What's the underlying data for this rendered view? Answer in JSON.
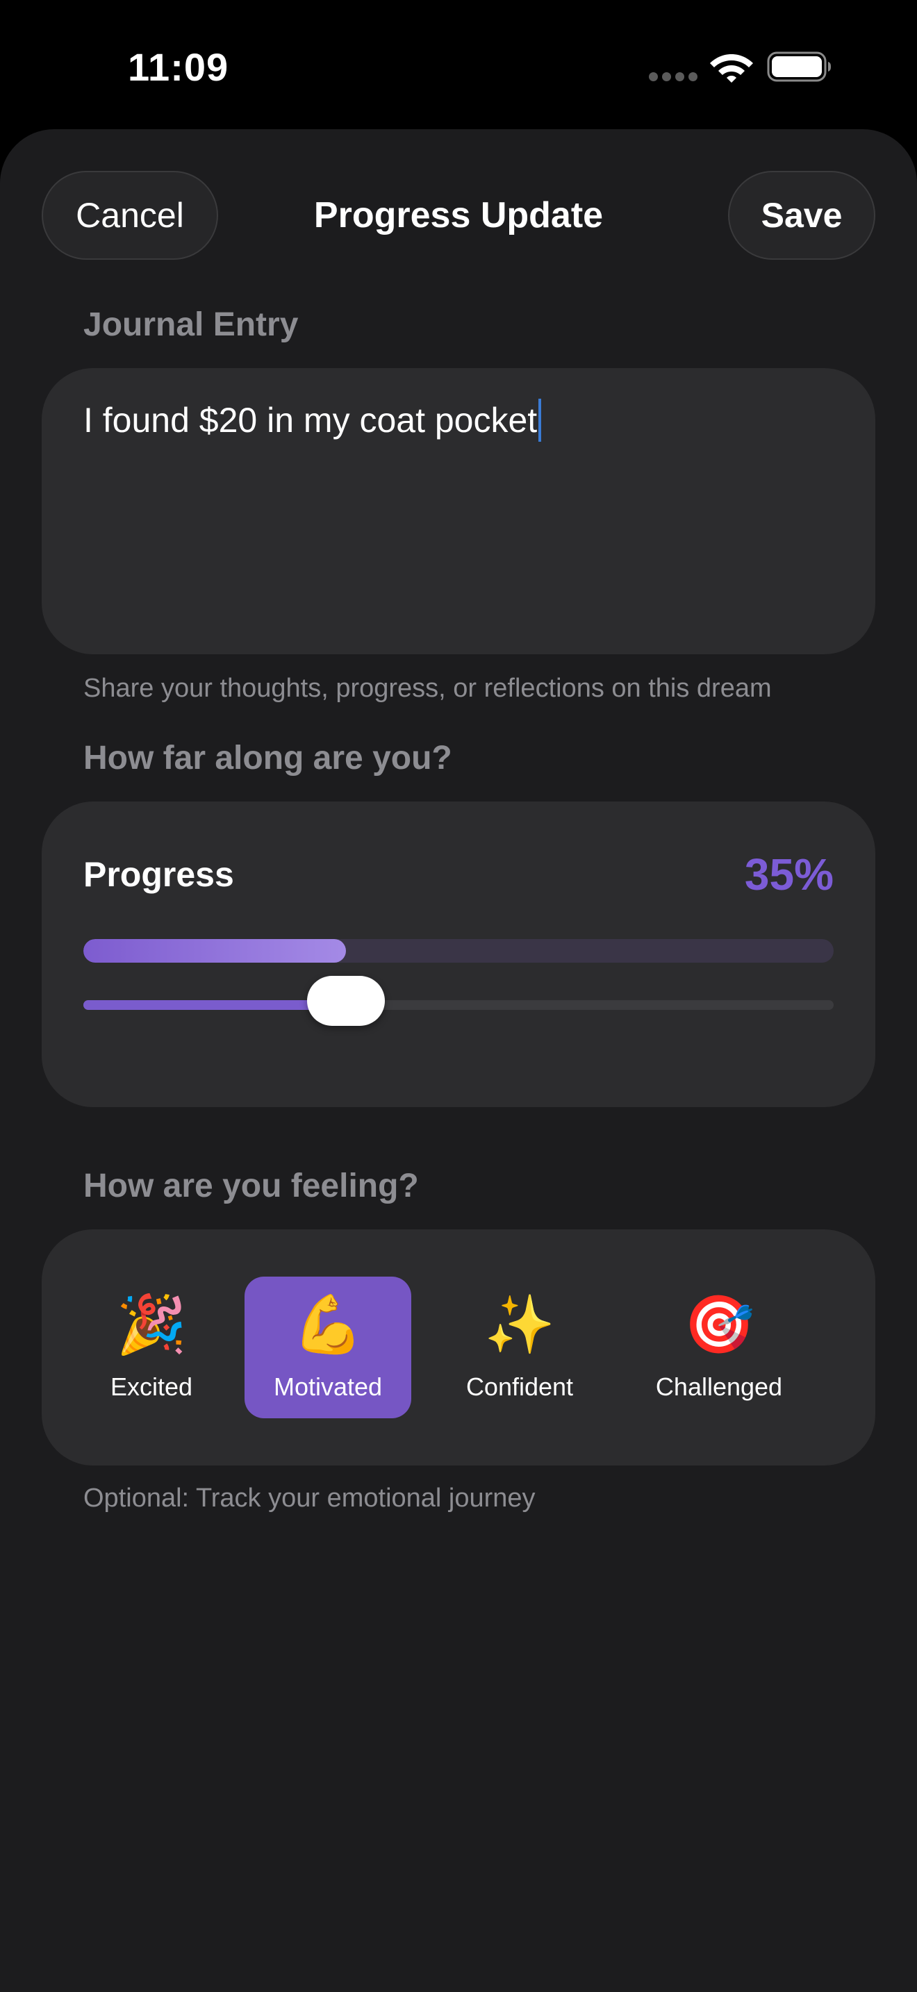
{
  "status_bar": {
    "time": "11:09"
  },
  "nav": {
    "cancel_label": "Cancel",
    "title": "Progress Update",
    "save_label": "Save"
  },
  "journal": {
    "section_label": "Journal Entry",
    "entry_text": "I found $20 in my coat pocket",
    "helper": "Share your thoughts, progress, or reflections on this dream"
  },
  "progress": {
    "section_label": "How far along are you?",
    "title": "Progress",
    "value_label": "35%",
    "value_fraction": 0.35
  },
  "mood": {
    "section_label": "How are you feeling?",
    "items": [
      {
        "emoji": "🎉",
        "label": "Excited",
        "selected": false
      },
      {
        "emoji": "💪",
        "label": "Motivated",
        "selected": true
      },
      {
        "emoji": "✨",
        "label": "Confident",
        "selected": false
      },
      {
        "emoji": "🎯",
        "label": "Challenged",
        "selected": false
      }
    ],
    "helper": "Optional: Track your emotional journey"
  },
  "colors": {
    "background": "#1c1c1e",
    "card": "#2c2c2e",
    "accent": "#7c5cd6",
    "secondary_text": "#8d8d92"
  }
}
